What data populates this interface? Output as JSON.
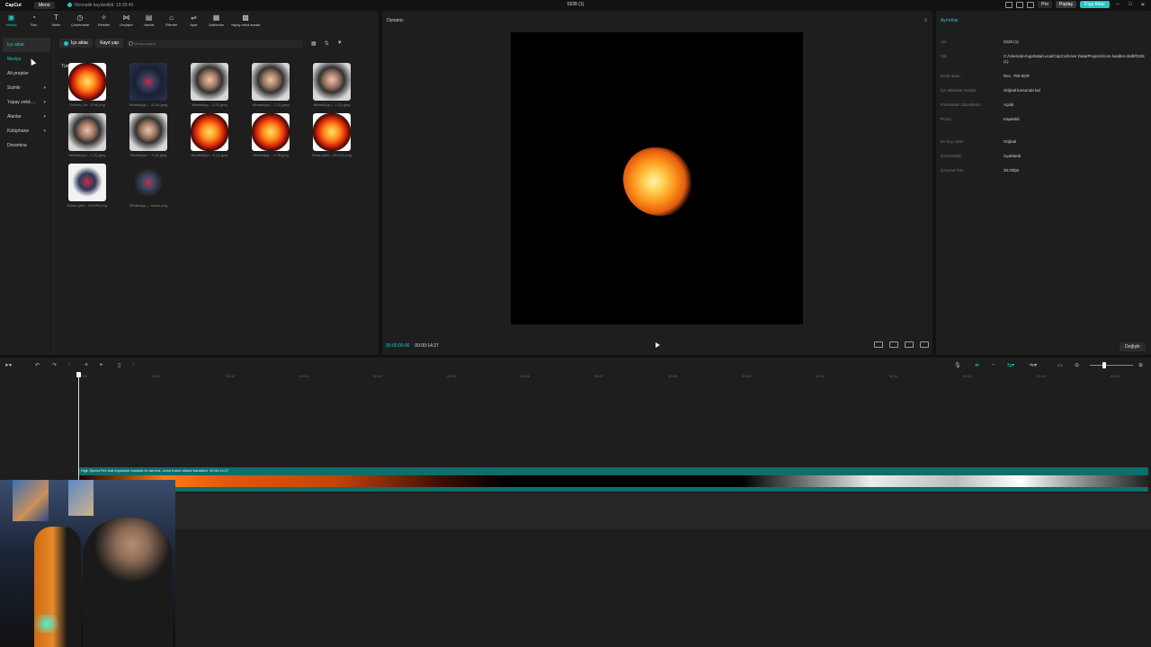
{
  "app": {
    "logo": "CapCut",
    "menu": "Menü",
    "autosave": "Otomatik kaydedildi: 19:39:40",
    "project_title": "0228 (1)",
    "pro": "Pro",
    "share": "Paylaş",
    "export": "Dışa Aktar",
    "accent_color": "#20c7c7"
  },
  "toolbar": [
    {
      "label": "Medya",
      "icon": "media-icon"
    },
    {
      "label": "Ses",
      "icon": "audio-icon"
    },
    {
      "label": "Metin",
      "icon": "text-icon"
    },
    {
      "label": "Çıkartmalar",
      "icon": "sticker-icon"
    },
    {
      "label": "Efektler",
      "icon": "effects-icon"
    },
    {
      "label": "Geçişler",
      "icon": "transitions-icon"
    },
    {
      "label": "Yazılar",
      "icon": "captions-icon"
    },
    {
      "label": "Filtreler",
      "icon": "filters-icon"
    },
    {
      "label": "Ayar",
      "icon": "adjust-icon"
    },
    {
      "label": "Şablonlar",
      "icon": "templates-icon"
    },
    {
      "label": "Yapay zekâ avatar",
      "icon": "ai-avatar-icon"
    }
  ],
  "sidebar": {
    "items": [
      {
        "label": "İçe aktar"
      },
      {
        "label": "Medya"
      },
      {
        "label": "Alt projeler"
      },
      {
        "label": "Sizinki"
      },
      {
        "label": "Yapay zekâ ..."
      },
      {
        "label": "Alanlar"
      },
      {
        "label": "Kütüphane"
      },
      {
        "label": "Dreamina"
      }
    ]
  },
  "media": {
    "import": "İçe aktar",
    "record": "Kayıt yap",
    "search_placeholder": "Medya arayın",
    "all_label": "Tümü",
    "items": [
      {
        "name": "Gemini_Ge...07wl.png",
        "kind": "fire"
      },
      {
        "name": "WhatsApp I...41.54.jpeg",
        "kind": "logo"
      },
      {
        "name": "WhatsApp ...2.02.jpeg",
        "kind": "face"
      },
      {
        "name": "WhatsApp I...2 (1).jpeg",
        "kind": "face"
      },
      {
        "name": "WhatsApp I...2 (2).jpeg",
        "kind": "face"
      },
      {
        "name": "WhatsApp I...2 (3).jpeg",
        "kind": "face"
      },
      {
        "name": "WhatsApp I...2 (4).jpeg",
        "kind": "face"
      },
      {
        "name": "WhatsApp I...3 (1).jpeg",
        "kind": "fire"
      },
      {
        "name": "WhatsApp ...2.28.jpeg",
        "kind": "fire"
      },
      {
        "name": "Ekran görü...164242.png",
        "kind": "fire"
      },
      {
        "name": "Ekran görü...161504.png",
        "kind": "logo-white"
      },
      {
        "name": "WhatsApp_...ewtxs.png",
        "kind": "logo-trans"
      }
    ]
  },
  "player": {
    "title": "Oynatıcı",
    "current_time": "00:00:00:00",
    "total_time": "00:00:14:27"
  },
  "details": {
    "title": "Ayrıntılar",
    "rows": [
      {
        "key": "Ad:",
        "value": "0228 (1)"
      },
      {
        "key": "Yol:",
        "value": "C:/Users/pc/AppData/Local/CapCut/User Data/Projects/com.lveditor.draft/0228 (1)"
      },
      {
        "key": "Renk alanı:",
        "value": "Rec. 709 SDR"
      },
      {
        "key": "İçe aktarılan medya:",
        "value": "Orijinal konumda kal"
      },
      {
        "key": "Katmanları düzenleyin:",
        "value": "Açıldı"
      },
      {
        "key": "Proxy:",
        "value": "Kapatıldı"
      },
      {
        "key": "En boy oranı:",
        "value": "Orijinal"
      },
      {
        "key": "Çözünürlük:",
        "value": "Uyarlandı"
      },
      {
        "key": "Çerçeve hızı:",
        "value": "30.00fps"
      }
    ],
    "modify": "Değiştir"
  },
  "timeline": {
    "ruler": [
      "00:00",
      "00:01",
      "00:02",
      "00:03",
      "00:04",
      "00:05",
      "00:06",
      "00:07",
      "00:08",
      "00:09",
      "00:10",
      "00:11",
      "00:12",
      "00:13",
      "00:14"
    ],
    "clip_label": "High Speed Fire ball explosion towards to camera, cross frame ahead transition",
    "clip_duration": "00:00:14:27"
  }
}
